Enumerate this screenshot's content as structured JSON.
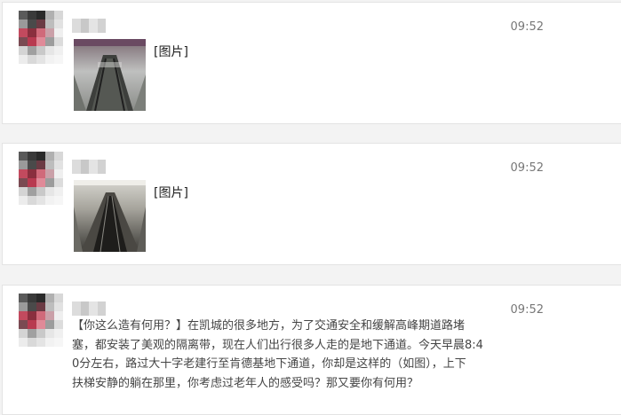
{
  "posts": [
    {
      "time": "09:52",
      "image_label": "[图片]",
      "image_icon": "escalator-photo"
    },
    {
      "time": "09:52",
      "image_label": "[图片]",
      "image_icon": "escalator-photo"
    },
    {
      "time": "09:52",
      "text_lines": [
        "【你这么造有何用？】在凯城的很多地方，为了交通安全和缓解高峰期道路堵",
        "塞，都安装了美观的隔离带，现在人们出行很多人走的是地下通道。今天早晨8:4",
        "0分左右，路过大十字老建行至肯德基地下通道，你却是这样的（如图），上下",
        "扶梯安静的躺在那里，你考虑过老年人的感受吗？那又要你有何用？"
      ]
    }
  ],
  "colors": {
    "card_bg": "#ffffff",
    "page_bg": "#f3f3f3",
    "avatar_mosaic": [
      "#3a3a3a",
      "#b9b9b9",
      "#7a4a52",
      "#d06a7a",
      "#9c9c9c",
      "#e0e0e0"
    ]
  }
}
